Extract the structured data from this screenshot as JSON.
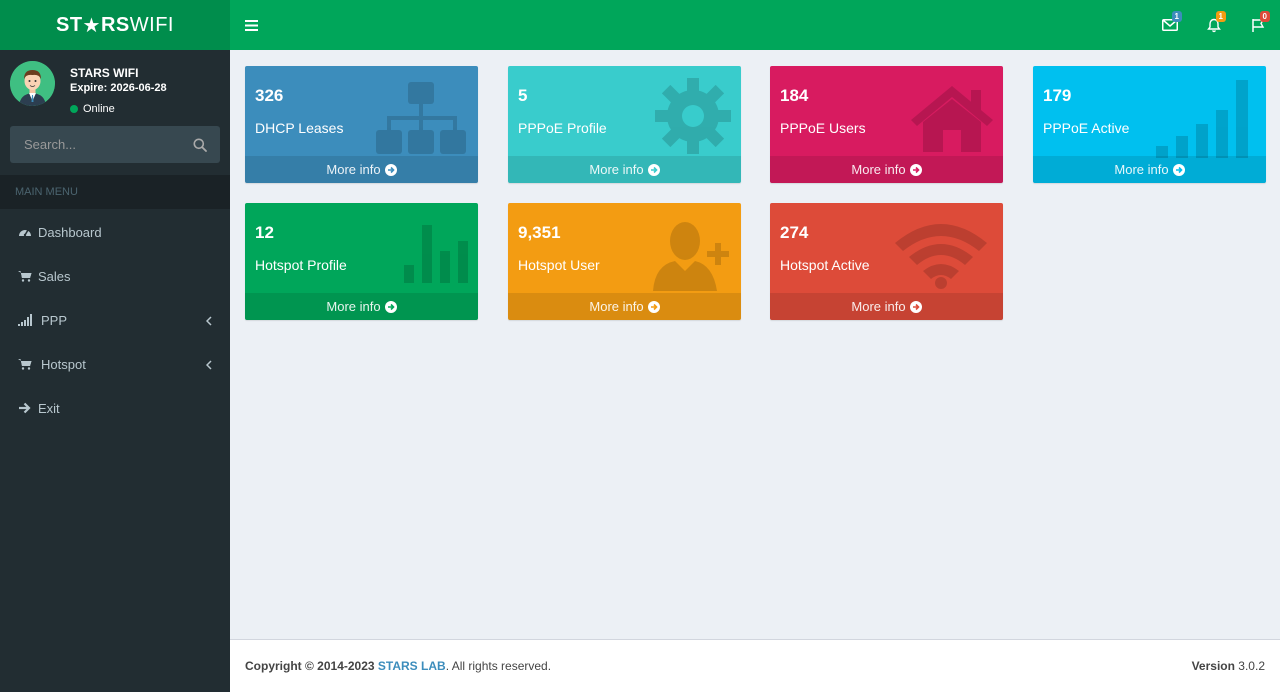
{
  "brand": {
    "part1": "ST",
    "star": "★",
    "part2": "RS",
    "part3": " WIFI"
  },
  "header": {
    "badges": {
      "messages": "1",
      "notifications": "1",
      "tasks": "0"
    },
    "colors": {
      "messages": "#3c8dbc",
      "notifications": "#f39c12",
      "tasks": "#dd4b39"
    }
  },
  "user": {
    "name": "STARS WIFI",
    "expire": "Expire: 2026-06-28",
    "status": "Online"
  },
  "search": {
    "placeholder": "Search..."
  },
  "sidebar": {
    "header": "MAIN MENU",
    "items": [
      {
        "label": "Dashboard",
        "icon": "dashboard-icon"
      },
      {
        "label": "Sales",
        "icon": "cart-icon"
      },
      {
        "label": "PPP",
        "icon": "signal-icon"
      },
      {
        "label": "Hotspot",
        "icon": "cart-icon"
      },
      {
        "label": "Exit",
        "icon": "arrow-right-icon"
      }
    ]
  },
  "boxes": [
    {
      "value": "326",
      "label": "DHCP Leases",
      "more": "More info",
      "color": "#3c8dbc",
      "icon": "sitemap-icon"
    },
    {
      "value": "5",
      "label": "PPPoE Profile",
      "more": "More info",
      "color": "#39cccc",
      "icon": "gear-icon"
    },
    {
      "value": "184",
      "label": "PPPoE Users",
      "more": "More info",
      "color": "#d81b60",
      "icon": "home-icon"
    },
    {
      "value": "179",
      "label": "PPPoE Active",
      "more": "More info",
      "color": "#00c0ef",
      "icon": "signal-bars-icon"
    },
    {
      "value": "12",
      "label": "Hotspot Profile",
      "more": "More info",
      "color": "#00a65a",
      "icon": "bar-chart-icon"
    },
    {
      "value": "9,351",
      "label": "Hotspot User",
      "more": "More info",
      "color": "#f39c12",
      "icon": "user-plus-icon"
    },
    {
      "value": "274",
      "label": "Hotspot Active",
      "more": "More info",
      "color": "#dd4b39",
      "icon": "wifi-icon"
    }
  ],
  "footer": {
    "copyright": "Copyright © 2014-2023",
    "company": "STARS LAB",
    "rights": ". All rights reserved.",
    "version_label": "Version",
    "version": "3.0.2"
  }
}
